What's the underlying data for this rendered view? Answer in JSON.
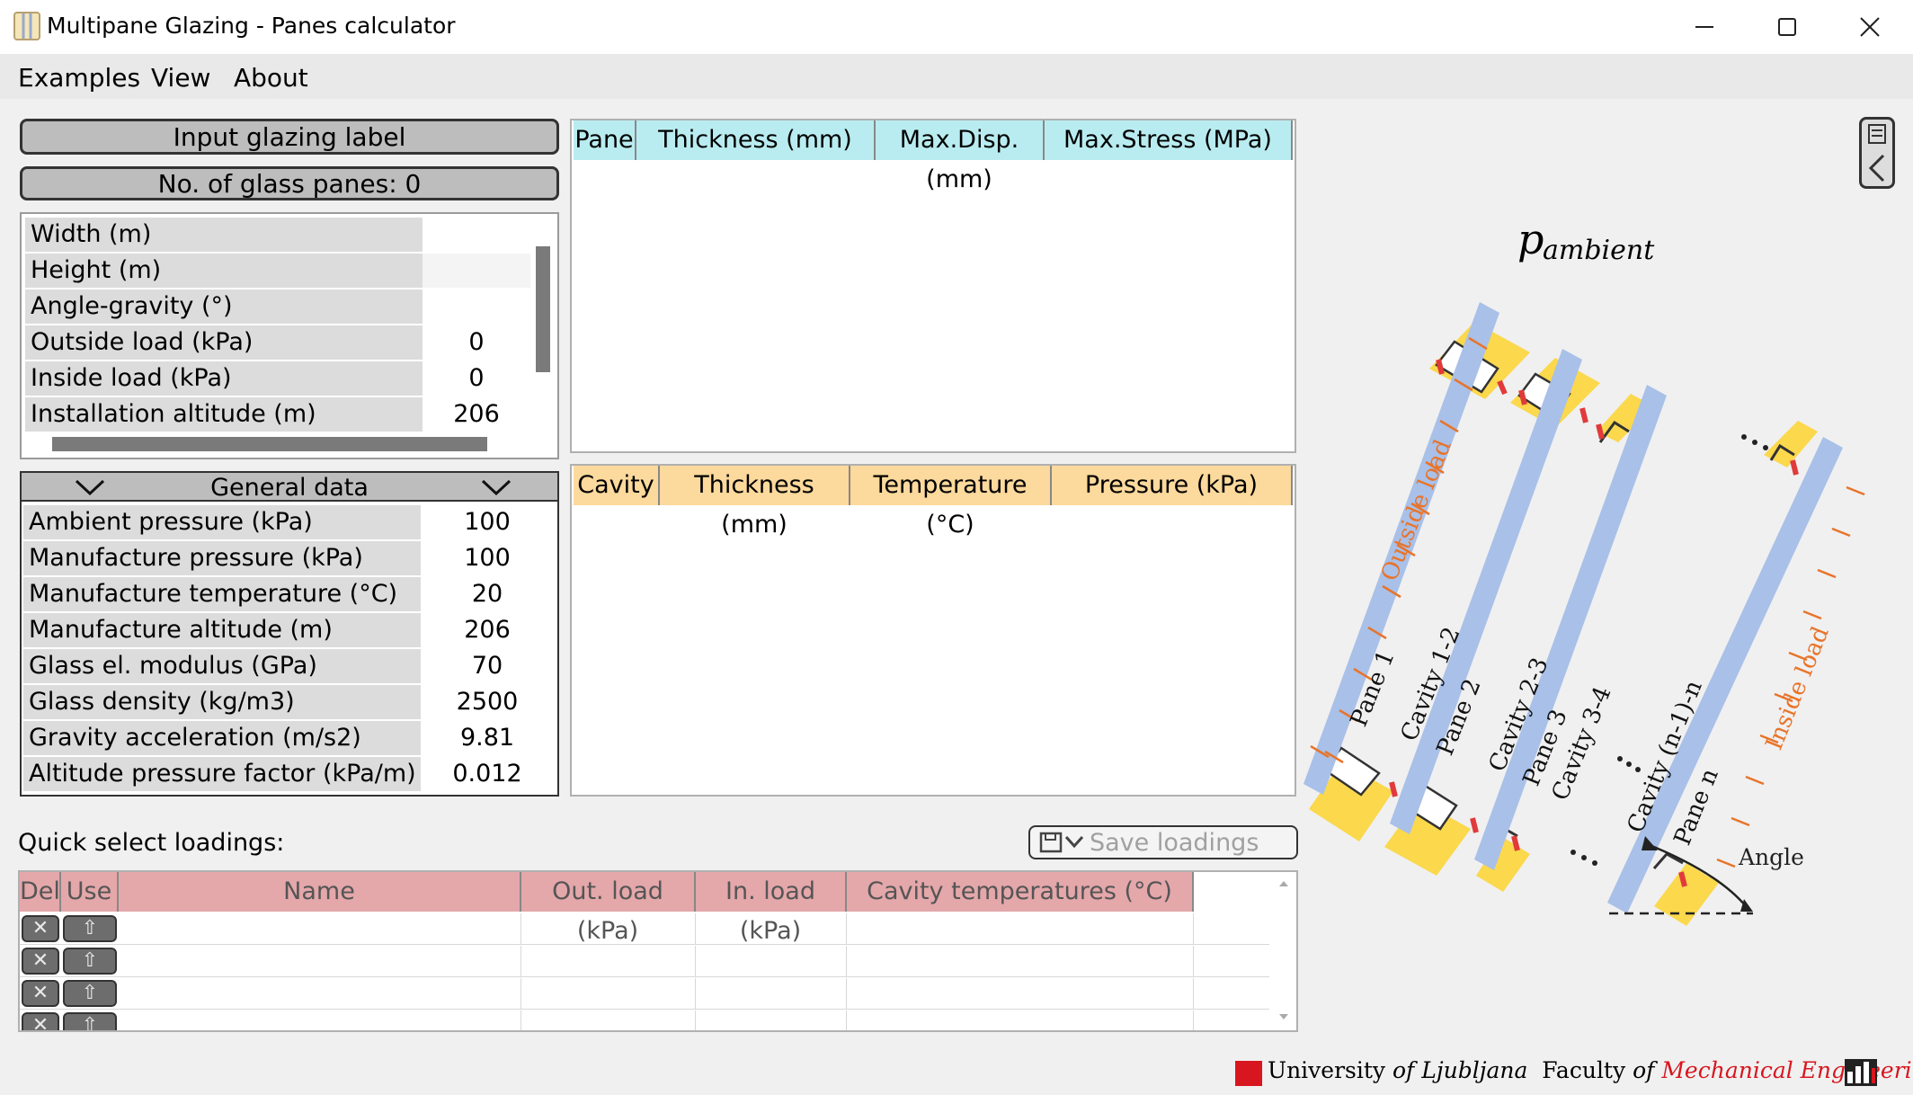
{
  "window": {
    "title": "Multipane Glazing - Panes calculator"
  },
  "menu": [
    "Examples",
    "View",
    "About"
  ],
  "buttons": {
    "label": "Input glazing label",
    "panes": "No. of glass panes: 0",
    "save": "Save loadings"
  },
  "properties": [
    {
      "name": "Width (m)",
      "value": ""
    },
    {
      "name": "Height (m)",
      "value": ""
    },
    {
      "name": "Angle-gravity (°)",
      "value": ""
    },
    {
      "name": "Outside load (kPa)",
      "value": "0"
    },
    {
      "name": "Inside load (kPa)",
      "value": "0"
    },
    {
      "name": "Installation altitude (m)",
      "value": "206"
    }
  ],
  "general": {
    "title": "General data",
    "rows": [
      {
        "name": "Ambient pressure (kPa)",
        "value": "100"
      },
      {
        "name": "Manufacture pressure (kPa)",
        "value": "100"
      },
      {
        "name": "Manufacture temperature (°C)",
        "value": "20"
      },
      {
        "name": "Manufacture altitude (m)",
        "value": "206"
      },
      {
        "name": "Glass el. modulus (GPa)",
        "value": "70"
      },
      {
        "name": "Glass density (kg/m3)",
        "value": "2500"
      },
      {
        "name": "Gravity acceleration (m/s2)",
        "value": "9.81"
      },
      {
        "name": "Altitude pressure factor (kPa/m)",
        "value": "0.012"
      }
    ]
  },
  "pane_table": {
    "headers": [
      "Pane",
      "Thickness (mm)",
      "Max.Disp.(mm)",
      "Max.Stress (MPa)"
    ]
  },
  "cavity_table": {
    "headers": [
      "Cavity",
      "Thickness (mm)",
      "Temperature (°C)",
      "Pressure (kPa)"
    ]
  },
  "quick": {
    "label": "Quick select loadings:",
    "headers": [
      "Del",
      "Use",
      "Name",
      "Out. load (kPa)",
      "In. load (kPa)",
      "Cavity temperatures (°C)"
    ]
  },
  "diagram": {
    "p": "p",
    "ambient": "ambient",
    "outside_load": "Outside load",
    "inside_load": "Inside load",
    "angle": "Angle",
    "pane1": "Pane 1",
    "pane2": "Pane 2",
    "pane3": "Pane 3",
    "panen": "Pane n",
    "cav12": "Cavity 1-2",
    "cav23": "Cavity 2-3",
    "cav34": "Cavity 3-4",
    "cavn": "Cavity (n-1)-n"
  },
  "footer": {
    "univ": "University",
    "of1": "of",
    "ljubljana": "Ljubljana",
    "faculty": "Faculty",
    "of2": "of",
    "mech": "Mechanical Engineering"
  },
  "colors": {
    "pane_blue": "#a9c0e8",
    "spacer_yellow": "#fbd84c",
    "load_orange": "#e8742a",
    "seal_red": "#e03a3a"
  }
}
